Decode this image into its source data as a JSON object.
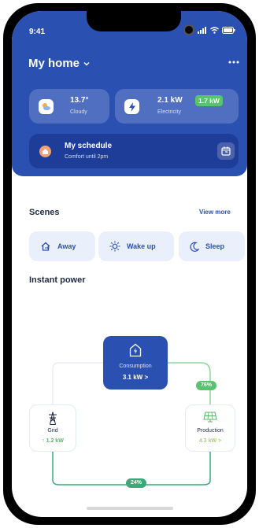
{
  "status_bar": {
    "time": "9:41"
  },
  "header": {
    "title": "My home",
    "weather": {
      "temperature": "13.7°",
      "condition": "Cloudy"
    },
    "power": {
      "value": "2.1 kW",
      "label": "Electricity",
      "badge": "1.7 kW"
    },
    "schedule": {
      "title": "My schedule",
      "subtitle": "Comfort until 2pm"
    }
  },
  "scenes": {
    "title": "Scenes",
    "view_more": "View more",
    "items": [
      {
        "label": "Away",
        "icon": "away-icon"
      },
      {
        "label": "Wake up",
        "icon": "sun-icon"
      },
      {
        "label": "Sleep",
        "icon": "moon-icon"
      }
    ]
  },
  "instant_power": {
    "title": "Instant power",
    "consumption": {
      "label": "Consumption",
      "value": "3.1 kW  >"
    },
    "grid": {
      "label": "Grid",
      "value": "↑ 1.2 kW"
    },
    "production": {
      "label": "Production",
      "value": "4.3 kW  >"
    },
    "production_share": "76%",
    "grid_share": "24%"
  },
  "colors": {
    "primary": "#2a50b2",
    "header_bg": "#2a50b2",
    "accent_green": "#57c56d",
    "schedule_orange": "#f3a074"
  }
}
